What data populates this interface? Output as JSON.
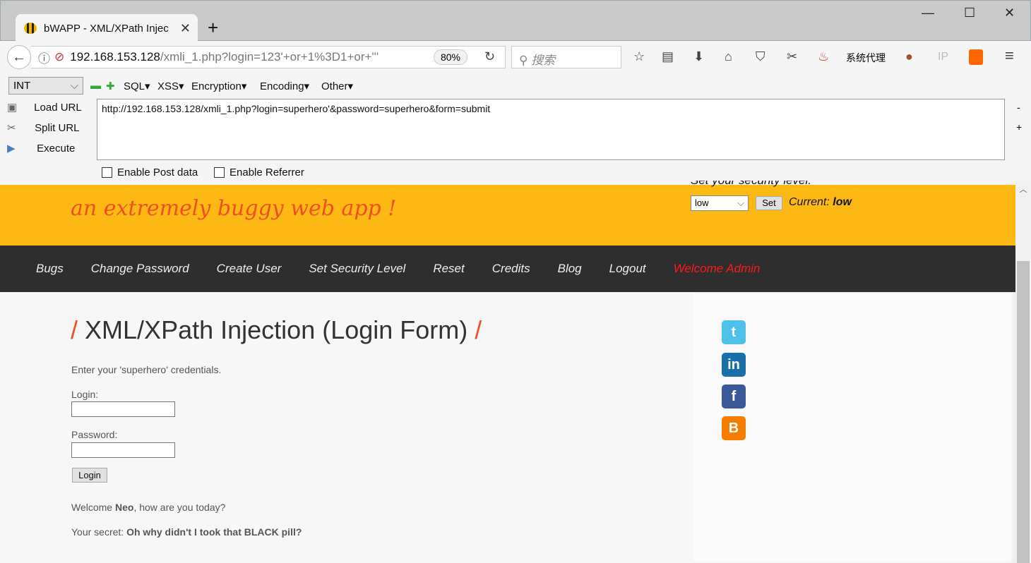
{
  "browser": {
    "tab_title": "bWAPP - XML/XPath Injec",
    "url_host": "192.168.153.128",
    "url_path": "/xmli_1.php?login=123'+or+1%3D1+or+'''",
    "zoom": "80%",
    "search_placeholder": "搜索",
    "proxy_label": "系统代理",
    "ip_label": "IP"
  },
  "hackbar": {
    "type_select": "INT",
    "menus": [
      "SQL▾",
      "XSS▾",
      "Encryption▾",
      "Encoding▾",
      "Other▾"
    ],
    "load_url": "Load URL",
    "split_url": "Split URL",
    "execute": "Execute",
    "url_value": "http://192.168.153.128/xmli_1.php?login=superhero'&password=superhero&form=submit",
    "enable_post": "Enable Post data",
    "enable_referrer": "Enable Referrer",
    "minus": "-",
    "plus": "+"
  },
  "header": {
    "tagline": "an extremely buggy web app !",
    "security_label": "Set your security level:",
    "security_value": "low",
    "set_button": "Set",
    "current_label": "Current:",
    "current_value": "low"
  },
  "menu": [
    "Bugs",
    "Change Password",
    "Create User",
    "Set Security Level",
    "Reset",
    "Credits",
    "Blog",
    "Logout",
    "Welcome Admin"
  ],
  "main": {
    "title": "XML/XPath Injection (Login Form)",
    "slash": "/",
    "intro": "Enter your 'superhero' credentials.",
    "login_label": "Login:",
    "password_label": "Password:",
    "login_button": "Login",
    "welcome_prefix": "Welcome ",
    "welcome_name": "Neo",
    "welcome_suffix": ", how are you today?",
    "secret_prefix": "Your secret: ",
    "secret": "Oh why didn't I took that BLACK pill?"
  },
  "social": {
    "twitter": "t",
    "linkedin": "in",
    "facebook": "f",
    "blogger": "B"
  }
}
